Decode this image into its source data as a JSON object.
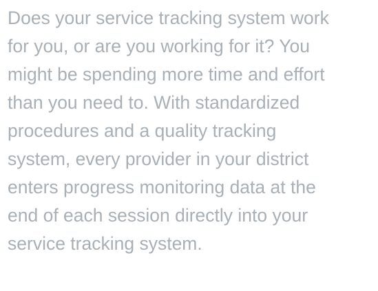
{
  "article": {
    "paragraph_lines": [
      "Does your service tracking system work",
      "for you, or are you working for it? You",
      "might be spending more time and effort",
      "than you need to. With standardized",
      "procedures and a quality tracking",
      "system, every provider in your district",
      "enters progress monitoring data at the",
      "end of each session directly into your",
      "service tracking system."
    ],
    "text_color": "#a8b0b6"
  }
}
